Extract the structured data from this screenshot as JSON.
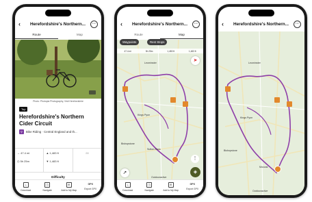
{
  "phones": [
    {
      "title": "Herefordshire's Northern...",
      "tabs": [
        "Route",
        "Map"
      ],
      "active_tab": "Route"
    },
    {
      "title": "Herefordshire's Northern...",
      "tabs": [
        "Route",
        "Map"
      ],
      "active_tab": "Map"
    },
    {
      "title": "Herefordshire's Northern...",
      "tabs": [],
      "active_tab": ""
    }
  ],
  "route": {
    "photo_caption": "Photo: Photopia Photography, Visit Herefordshire",
    "badge": "Top",
    "title": "Herefordshire's Northern Cider Circuit",
    "category": "Bike Riding · Central England and th...",
    "stats": {
      "distance": "47.4 mi",
      "duration": "5h 25m",
      "ascent": "1,483 ft",
      "descent": "1,483 ft",
      "extra": "28"
    },
    "difficulty_label": "Difficulty"
  },
  "toolbar": [
    {
      "label": "Download",
      "icon": "download-icon",
      "glyph": "⤓"
    },
    {
      "label": "Navigate",
      "icon": "navigate-icon",
      "glyph": "◳"
    },
    {
      "label": "Add to My Map",
      "icon": "add-map-icon",
      "glyph": "⊞"
    },
    {
      "label": "Export GPX",
      "icon": "gpx-icon",
      "glyph": "GPX"
    }
  ],
  "map": {
    "chips": [
      "Waypoints",
      "Rest Stops"
    ],
    "strip": {
      "distance": "47.4 mi",
      "time": "5h 25m",
      "up": "1,483 ft",
      "down": "1,483 ft"
    },
    "places": [
      "Leominster",
      "Kings Pyon",
      "Sutton-Ross",
      "Bishopstone",
      "Moccas"
    ],
    "attribution": "Outdooractive"
  },
  "colors": {
    "route": "#8e3ea8",
    "marker": "#e2882c",
    "button_green": "#4d5a24",
    "map_bg": "#e6eedc"
  }
}
